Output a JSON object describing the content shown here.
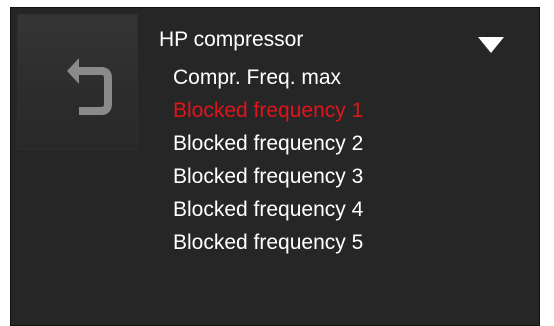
{
  "back_button": {
    "icon": "return-arrow-icon"
  },
  "menu": {
    "title": "HP compressor",
    "dropdown_icon": "triangle-down-icon",
    "items": [
      {
        "label": "Compr. Freq. max",
        "selected": false
      },
      {
        "label": "Blocked frequency 1",
        "selected": true
      },
      {
        "label": "Blocked frequency 2",
        "selected": false
      },
      {
        "label": "Blocked frequency 3",
        "selected": false
      },
      {
        "label": "Blocked frequency 4",
        "selected": false
      },
      {
        "label": "Blocked frequency 5",
        "selected": false
      }
    ]
  },
  "colors": {
    "background": "#262626",
    "text": "#ffffff",
    "selected_text": "#e0141b",
    "icon": "#8a8a8a"
  }
}
